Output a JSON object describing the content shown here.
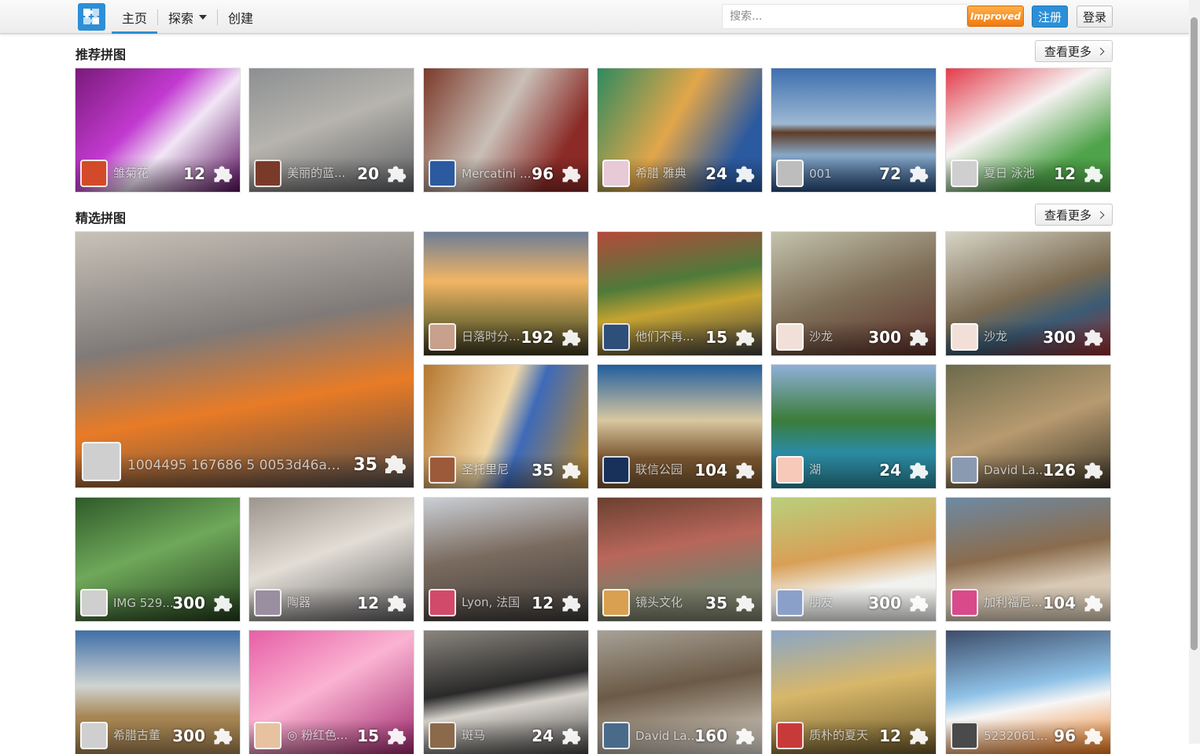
{
  "nav": {
    "home": "主页",
    "explore": "探索",
    "create": "创建",
    "search_placeholder": "搜索...",
    "improved_badge": "Improved",
    "register": "注册",
    "login": "登录"
  },
  "sections": {
    "recommended": {
      "title": "推荐拼图",
      "more": "查看更多"
    },
    "featured": {
      "title": "精选拼图",
      "more": "查看更多"
    }
  },
  "recommended": [
    {
      "title": "雏菊花",
      "count": "12"
    },
    {
      "title": "美丽的蓝...",
      "count": "20"
    },
    {
      "title": "Mercatini ...",
      "count": "96"
    },
    {
      "title": "希腊 雅典",
      "count": "24"
    },
    {
      "title": "001",
      "count": "72"
    },
    {
      "title": "夏日 泳池",
      "count": "12"
    }
  ],
  "featured": [
    {
      "title": "1004495 167686 5 0053d46a51...",
      "count": "35"
    },
    {
      "title": "日落时分...",
      "count": "192"
    },
    {
      "title": "他们不再...",
      "count": "15"
    },
    {
      "title": "沙龙",
      "count": "300"
    },
    {
      "title": "沙龙",
      "count": "300"
    },
    {
      "title": "圣托里尼",
      "count": "35"
    },
    {
      "title": "联信公园",
      "count": "104"
    },
    {
      "title": "湖",
      "count": "24"
    },
    {
      "title": "David La...",
      "count": "126"
    },
    {
      "title": "IMG 529...",
      "count": "300"
    },
    {
      "title": "陶器",
      "count": "12"
    },
    {
      "title": "Lyon, 法国",
      "count": "12"
    },
    {
      "title": "镜头文化",
      "count": "35"
    },
    {
      "title": "朋友",
      "count": "300"
    },
    {
      "title": "加利福尼...",
      "count": "104"
    },
    {
      "title": "希腊古董",
      "count": "300"
    },
    {
      "title": "◎ 粉红色...",
      "count": "15"
    },
    {
      "title": "斑马",
      "count": "24"
    },
    {
      "title": "David La...",
      "count": "160"
    },
    {
      "title": "质朴的夏天",
      "count": "12"
    },
    {
      "title": "523206140...",
      "count": "96"
    }
  ]
}
